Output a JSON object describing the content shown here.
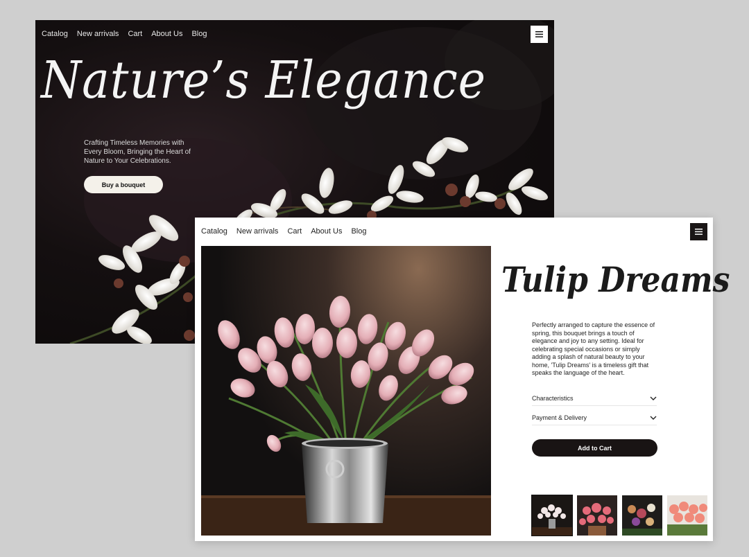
{
  "hero": {
    "nav": [
      "Catalog",
      "New arrivals",
      "Cart",
      "About Us",
      "Blog"
    ],
    "title": "Nature’s Elegance",
    "tagline": "Crafting Timeless Memories with Every Bloom, Bringing the Heart of Nature to Your Celebrations.",
    "cta_label": "Buy a bouquet",
    "menu_icon": "hamburger-icon"
  },
  "product": {
    "nav": [
      "Catalog",
      "New arrivals",
      "Cart",
      "About Us",
      "Blog"
    ],
    "title": "Tulip Dreams",
    "description": "Perfectly arranged to capture the essence of spring, this bouquet brings a touch of elegance and joy to any setting. Ideal for celebrating special occasions or simply adding a splash of natural beauty to your home, 'Tulip Dreams' is a timeless gift that speaks the language of the heart.",
    "accordions": [
      "Characteristics",
      "Payment & Delivery"
    ],
    "add_to_cart_label": "Add to Cart",
    "menu_icon": "hamburger-icon"
  },
  "colors": {
    "page_bg": "#cfcfcf",
    "hero_bg": "#0b0909",
    "button_dark": "#191414",
    "button_light": "#f4f1ea"
  }
}
